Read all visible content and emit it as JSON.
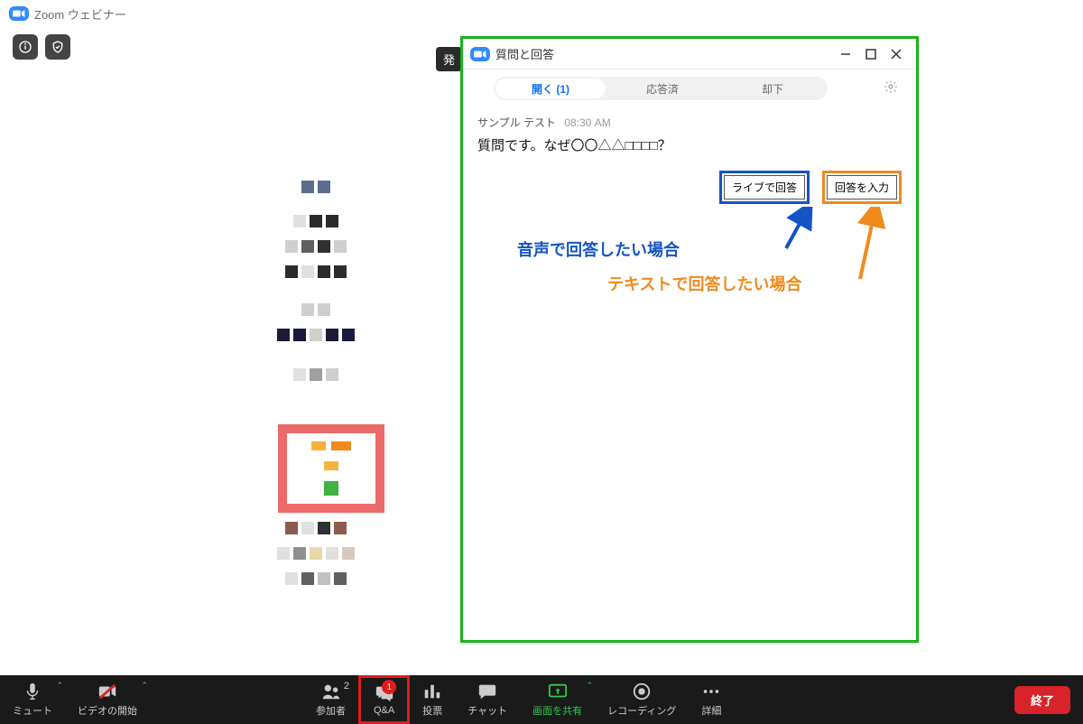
{
  "titlebar": {
    "app": "Zoom ウェビナー"
  },
  "peek_tag": "発",
  "qa": {
    "title": "質問と回答",
    "tabs": {
      "open": "開く (1)",
      "answered": "応答済",
      "dismissed": "却下"
    },
    "question": {
      "author": "サンプル テスト",
      "time": "08:30 AM",
      "text": "質問です。なぜ〇〇△△□□□□？"
    },
    "buttons": {
      "live": "ライブで回答",
      "type": "回答を入力"
    }
  },
  "annotations": {
    "audio": "音声で回答したい場合",
    "text": "テキストで回答したい場合"
  },
  "toolbar": {
    "mute": "ミュート",
    "video": "ビデオの開始",
    "participants": "参加者",
    "participants_count": "2",
    "qa": "Q&A",
    "qa_badge": "1",
    "poll": "投票",
    "chat": "チャット",
    "share": "画面を共有",
    "record": "レコーディング",
    "more": "詳細",
    "end": "終了"
  }
}
